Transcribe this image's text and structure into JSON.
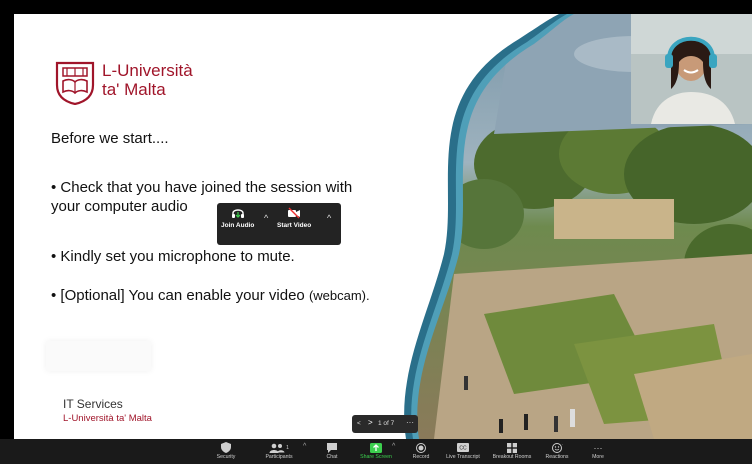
{
  "slide": {
    "brand_line1": "L-Università",
    "brand_line2": "ta' Malta",
    "intro": "Before we start....",
    "bullet1_line1": "• Check that you have joined the session with",
    "bullet1_line2": "your computer audio",
    "bullet2": "• Kindly set you microphone to mute.",
    "bullet3_main": "• [Optional] You can enable your video ",
    "bullet3_small": "(webcam).",
    "footer_dept": "IT Services",
    "footer_uni": "L-Università ta' Malta"
  },
  "av_popup": {
    "join_audio": "Join Audio",
    "start_video": "Start Video"
  },
  "slide_nav": {
    "page": "1 of 7"
  },
  "toolbar": {
    "items": [
      {
        "label": "Security",
        "icon": "shield-icon"
      },
      {
        "label": "Participants",
        "icon": "participants-icon",
        "count": "1"
      },
      {
        "label": "Chat",
        "icon": "chat-icon"
      },
      {
        "label": "Share Screen",
        "icon": "share-screen-icon"
      },
      {
        "label": "Record",
        "icon": "record-icon"
      },
      {
        "label": "Live Transcript",
        "icon": "cc-icon"
      },
      {
        "label": "Breakout Rooms",
        "icon": "breakout-icon"
      },
      {
        "label": "Reactions",
        "icon": "reactions-icon"
      },
      {
        "label": "More",
        "icon": "more-icon"
      }
    ]
  },
  "colors": {
    "brand": "#a0152a",
    "share_screen": "#3ccf4e",
    "toolbar_bg": "#1a1a1a"
  }
}
